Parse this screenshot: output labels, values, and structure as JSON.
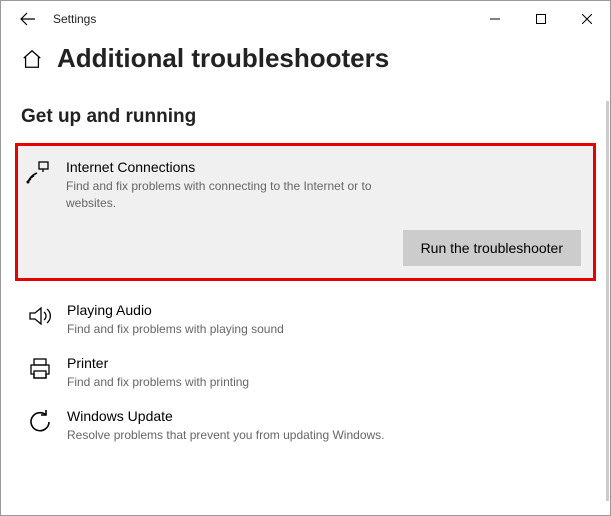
{
  "window": {
    "title": "Settings"
  },
  "header": {
    "page_title": "Additional troubleshooters"
  },
  "section": {
    "title": "Get up and running"
  },
  "troubleshooters": [
    {
      "title": "Internet Connections",
      "desc": "Find and fix problems with connecting to the Internet or to websites.",
      "run_label": "Run the troubleshooter"
    },
    {
      "title": "Playing Audio",
      "desc": "Find and fix problems with playing sound"
    },
    {
      "title": "Printer",
      "desc": "Find and fix problems with printing"
    },
    {
      "title": "Windows Update",
      "desc": "Resolve problems that prevent you from updating Windows."
    }
  ]
}
